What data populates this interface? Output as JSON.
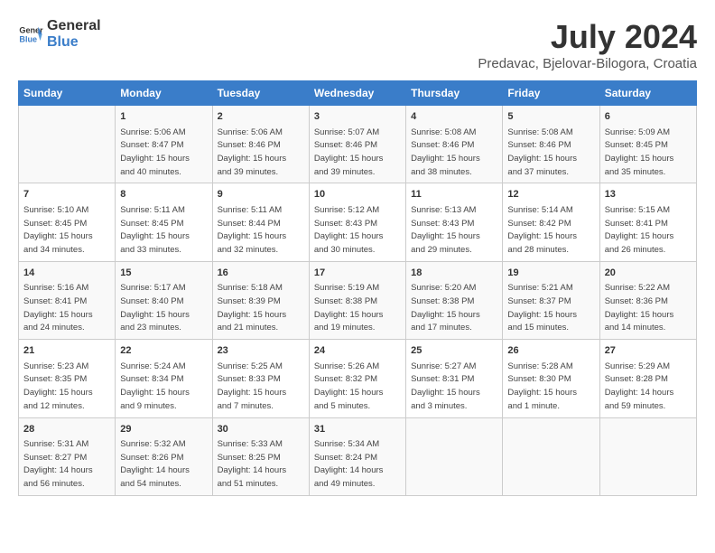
{
  "header": {
    "logo_general": "General",
    "logo_blue": "Blue",
    "month": "July 2024",
    "location": "Predavac, Bjelovar-Bilogora, Croatia"
  },
  "weekdays": [
    "Sunday",
    "Monday",
    "Tuesday",
    "Wednesday",
    "Thursday",
    "Friday",
    "Saturday"
  ],
  "weeks": [
    [
      {
        "day": "",
        "info": ""
      },
      {
        "day": "1",
        "info": "Sunrise: 5:06 AM\nSunset: 8:47 PM\nDaylight: 15 hours\nand 40 minutes."
      },
      {
        "day": "2",
        "info": "Sunrise: 5:06 AM\nSunset: 8:46 PM\nDaylight: 15 hours\nand 39 minutes."
      },
      {
        "day": "3",
        "info": "Sunrise: 5:07 AM\nSunset: 8:46 PM\nDaylight: 15 hours\nand 39 minutes."
      },
      {
        "day": "4",
        "info": "Sunrise: 5:08 AM\nSunset: 8:46 PM\nDaylight: 15 hours\nand 38 minutes."
      },
      {
        "day": "5",
        "info": "Sunrise: 5:08 AM\nSunset: 8:46 PM\nDaylight: 15 hours\nand 37 minutes."
      },
      {
        "day": "6",
        "info": "Sunrise: 5:09 AM\nSunset: 8:45 PM\nDaylight: 15 hours\nand 35 minutes."
      }
    ],
    [
      {
        "day": "7",
        "info": "Sunrise: 5:10 AM\nSunset: 8:45 PM\nDaylight: 15 hours\nand 34 minutes."
      },
      {
        "day": "8",
        "info": "Sunrise: 5:11 AM\nSunset: 8:45 PM\nDaylight: 15 hours\nand 33 minutes."
      },
      {
        "day": "9",
        "info": "Sunrise: 5:11 AM\nSunset: 8:44 PM\nDaylight: 15 hours\nand 32 minutes."
      },
      {
        "day": "10",
        "info": "Sunrise: 5:12 AM\nSunset: 8:43 PM\nDaylight: 15 hours\nand 30 minutes."
      },
      {
        "day": "11",
        "info": "Sunrise: 5:13 AM\nSunset: 8:43 PM\nDaylight: 15 hours\nand 29 minutes."
      },
      {
        "day": "12",
        "info": "Sunrise: 5:14 AM\nSunset: 8:42 PM\nDaylight: 15 hours\nand 28 minutes."
      },
      {
        "day": "13",
        "info": "Sunrise: 5:15 AM\nSunset: 8:41 PM\nDaylight: 15 hours\nand 26 minutes."
      }
    ],
    [
      {
        "day": "14",
        "info": "Sunrise: 5:16 AM\nSunset: 8:41 PM\nDaylight: 15 hours\nand 24 minutes."
      },
      {
        "day": "15",
        "info": "Sunrise: 5:17 AM\nSunset: 8:40 PM\nDaylight: 15 hours\nand 23 minutes."
      },
      {
        "day": "16",
        "info": "Sunrise: 5:18 AM\nSunset: 8:39 PM\nDaylight: 15 hours\nand 21 minutes."
      },
      {
        "day": "17",
        "info": "Sunrise: 5:19 AM\nSunset: 8:38 PM\nDaylight: 15 hours\nand 19 minutes."
      },
      {
        "day": "18",
        "info": "Sunrise: 5:20 AM\nSunset: 8:38 PM\nDaylight: 15 hours\nand 17 minutes."
      },
      {
        "day": "19",
        "info": "Sunrise: 5:21 AM\nSunset: 8:37 PM\nDaylight: 15 hours\nand 15 minutes."
      },
      {
        "day": "20",
        "info": "Sunrise: 5:22 AM\nSunset: 8:36 PM\nDaylight: 15 hours\nand 14 minutes."
      }
    ],
    [
      {
        "day": "21",
        "info": "Sunrise: 5:23 AM\nSunset: 8:35 PM\nDaylight: 15 hours\nand 12 minutes."
      },
      {
        "day": "22",
        "info": "Sunrise: 5:24 AM\nSunset: 8:34 PM\nDaylight: 15 hours\nand 9 minutes."
      },
      {
        "day": "23",
        "info": "Sunrise: 5:25 AM\nSunset: 8:33 PM\nDaylight: 15 hours\nand 7 minutes."
      },
      {
        "day": "24",
        "info": "Sunrise: 5:26 AM\nSunset: 8:32 PM\nDaylight: 15 hours\nand 5 minutes."
      },
      {
        "day": "25",
        "info": "Sunrise: 5:27 AM\nSunset: 8:31 PM\nDaylight: 15 hours\nand 3 minutes."
      },
      {
        "day": "26",
        "info": "Sunrise: 5:28 AM\nSunset: 8:30 PM\nDaylight: 15 hours\nand 1 minute."
      },
      {
        "day": "27",
        "info": "Sunrise: 5:29 AM\nSunset: 8:28 PM\nDaylight: 14 hours\nand 59 minutes."
      }
    ],
    [
      {
        "day": "28",
        "info": "Sunrise: 5:31 AM\nSunset: 8:27 PM\nDaylight: 14 hours\nand 56 minutes."
      },
      {
        "day": "29",
        "info": "Sunrise: 5:32 AM\nSunset: 8:26 PM\nDaylight: 14 hours\nand 54 minutes."
      },
      {
        "day": "30",
        "info": "Sunrise: 5:33 AM\nSunset: 8:25 PM\nDaylight: 14 hours\nand 51 minutes."
      },
      {
        "day": "31",
        "info": "Sunrise: 5:34 AM\nSunset: 8:24 PM\nDaylight: 14 hours\nand 49 minutes."
      },
      {
        "day": "",
        "info": ""
      },
      {
        "day": "",
        "info": ""
      },
      {
        "day": "",
        "info": ""
      }
    ]
  ]
}
